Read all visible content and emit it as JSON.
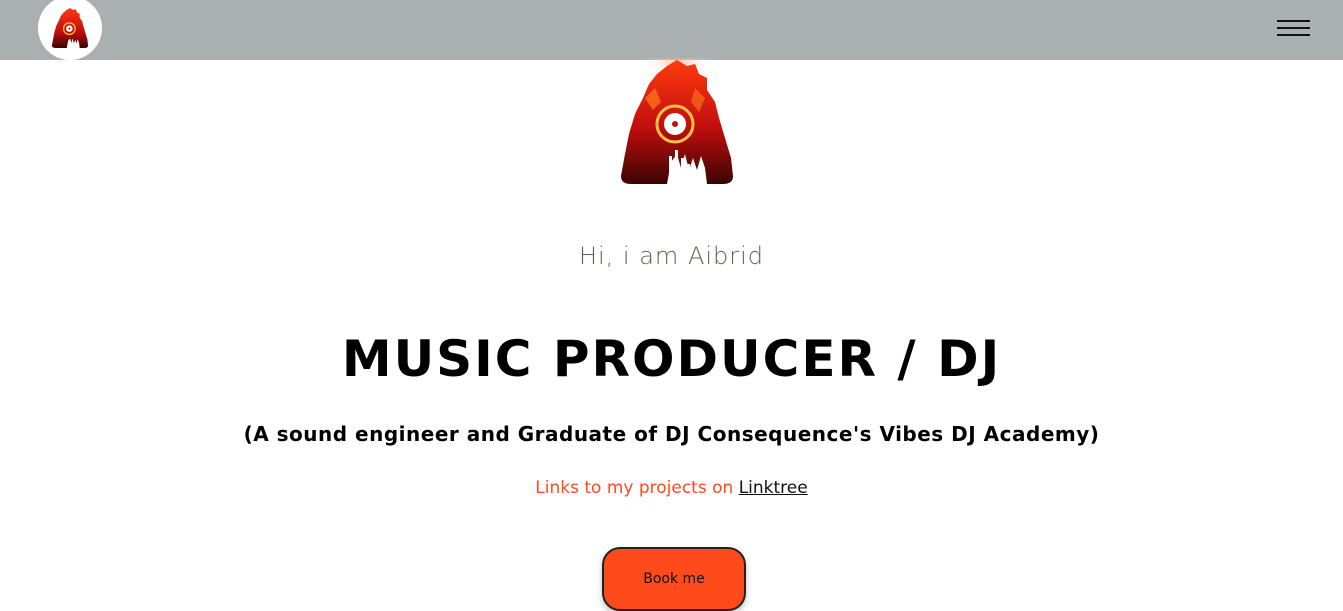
{
  "nav": {
    "logo_icon": "aibrid-logo-icon",
    "menu_icon": "hamburger-menu-icon"
  },
  "hero": {
    "logo_icon": "aibrid-logo-icon",
    "greeting": "Hi, i am Aibrid",
    "headline": "MUSIC PRODUCER / DJ",
    "subline": "(A sound engineer and Graduate of DJ Consequence's Vibes DJ Academy)",
    "links_prefix": "Links to my projects on ",
    "links_link_label": "Linktree",
    "book_button_label": "Book me"
  },
  "colors": {
    "navbar": "#aaafaf",
    "accent": "#ff4a1c",
    "greeting_text": "#6e5a5a"
  }
}
